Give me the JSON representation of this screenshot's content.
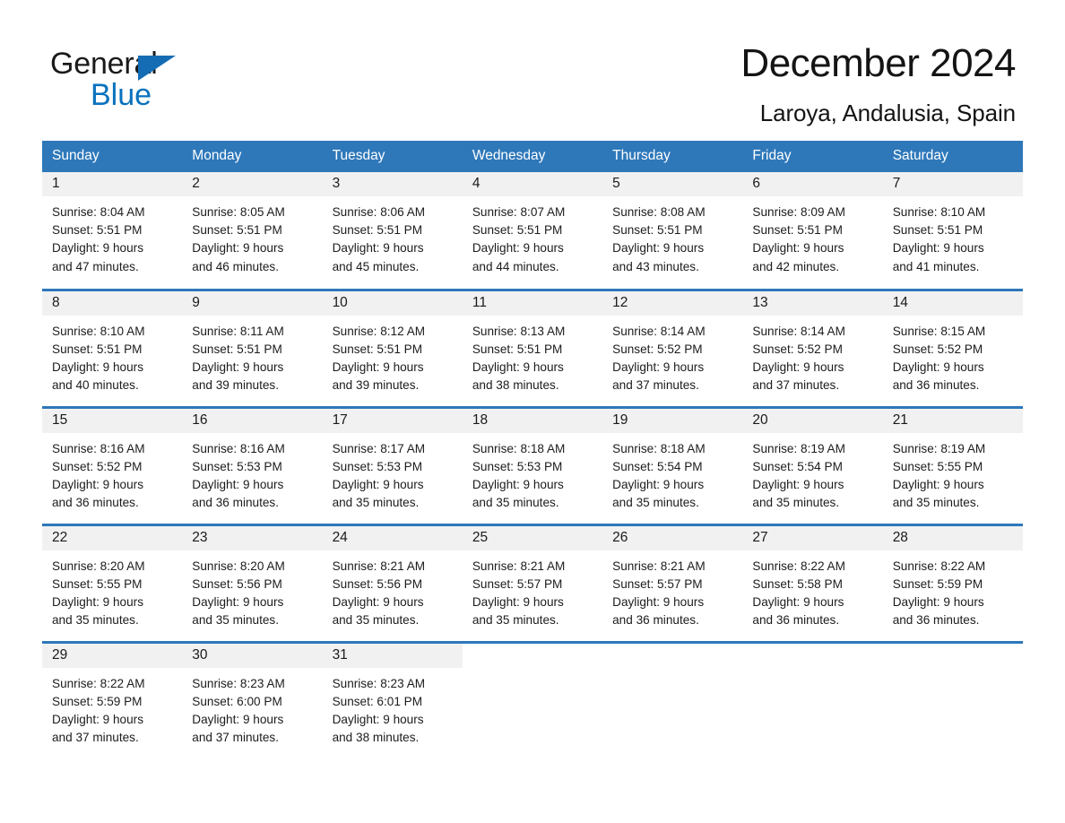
{
  "brand": {
    "name_top": "General",
    "name_bottom": "Blue",
    "accent_color": "#146cb4",
    "triangle_icon": "brand-triangle-icon"
  },
  "header": {
    "month_title": "December 2024",
    "location": "Laroya, Andalusia, Spain"
  },
  "theme": {
    "header_blue": "#2e78ba",
    "daynum_band": "#f1f1f1",
    "text": "#1a1a1a"
  },
  "calendar": {
    "weekday_headers": [
      "Sunday",
      "Monday",
      "Tuesday",
      "Wednesday",
      "Thursday",
      "Friday",
      "Saturday"
    ],
    "weeks": [
      [
        {
          "day": "1",
          "sunrise": "Sunrise: 8:04 AM",
          "sunset": "Sunset: 5:51 PM",
          "daylight_1": "Daylight: 9 hours",
          "daylight_2": "and 47 minutes."
        },
        {
          "day": "2",
          "sunrise": "Sunrise: 8:05 AM",
          "sunset": "Sunset: 5:51 PM",
          "daylight_1": "Daylight: 9 hours",
          "daylight_2": "and 46 minutes."
        },
        {
          "day": "3",
          "sunrise": "Sunrise: 8:06 AM",
          "sunset": "Sunset: 5:51 PM",
          "daylight_1": "Daylight: 9 hours",
          "daylight_2": "and 45 minutes."
        },
        {
          "day": "4",
          "sunrise": "Sunrise: 8:07 AM",
          "sunset": "Sunset: 5:51 PM",
          "daylight_1": "Daylight: 9 hours",
          "daylight_2": "and 44 minutes."
        },
        {
          "day": "5",
          "sunrise": "Sunrise: 8:08 AM",
          "sunset": "Sunset: 5:51 PM",
          "daylight_1": "Daylight: 9 hours",
          "daylight_2": "and 43 minutes."
        },
        {
          "day": "6",
          "sunrise": "Sunrise: 8:09 AM",
          "sunset": "Sunset: 5:51 PM",
          "daylight_1": "Daylight: 9 hours",
          "daylight_2": "and 42 minutes."
        },
        {
          "day": "7",
          "sunrise": "Sunrise: 8:10 AM",
          "sunset": "Sunset: 5:51 PM",
          "daylight_1": "Daylight: 9 hours",
          "daylight_2": "and 41 minutes."
        }
      ],
      [
        {
          "day": "8",
          "sunrise": "Sunrise: 8:10 AM",
          "sunset": "Sunset: 5:51 PM",
          "daylight_1": "Daylight: 9 hours",
          "daylight_2": "and 40 minutes."
        },
        {
          "day": "9",
          "sunrise": "Sunrise: 8:11 AM",
          "sunset": "Sunset: 5:51 PM",
          "daylight_1": "Daylight: 9 hours",
          "daylight_2": "and 39 minutes."
        },
        {
          "day": "10",
          "sunrise": "Sunrise: 8:12 AM",
          "sunset": "Sunset: 5:51 PM",
          "daylight_1": "Daylight: 9 hours",
          "daylight_2": "and 39 minutes."
        },
        {
          "day": "11",
          "sunrise": "Sunrise: 8:13 AM",
          "sunset": "Sunset: 5:51 PM",
          "daylight_1": "Daylight: 9 hours",
          "daylight_2": "and 38 minutes."
        },
        {
          "day": "12",
          "sunrise": "Sunrise: 8:14 AM",
          "sunset": "Sunset: 5:52 PM",
          "daylight_1": "Daylight: 9 hours",
          "daylight_2": "and 37 minutes."
        },
        {
          "day": "13",
          "sunrise": "Sunrise: 8:14 AM",
          "sunset": "Sunset: 5:52 PM",
          "daylight_1": "Daylight: 9 hours",
          "daylight_2": "and 37 minutes."
        },
        {
          "day": "14",
          "sunrise": "Sunrise: 8:15 AM",
          "sunset": "Sunset: 5:52 PM",
          "daylight_1": "Daylight: 9 hours",
          "daylight_2": "and 36 minutes."
        }
      ],
      [
        {
          "day": "15",
          "sunrise": "Sunrise: 8:16 AM",
          "sunset": "Sunset: 5:52 PM",
          "daylight_1": "Daylight: 9 hours",
          "daylight_2": "and 36 minutes."
        },
        {
          "day": "16",
          "sunrise": "Sunrise: 8:16 AM",
          "sunset": "Sunset: 5:53 PM",
          "daylight_1": "Daylight: 9 hours",
          "daylight_2": "and 36 minutes."
        },
        {
          "day": "17",
          "sunrise": "Sunrise: 8:17 AM",
          "sunset": "Sunset: 5:53 PM",
          "daylight_1": "Daylight: 9 hours",
          "daylight_2": "and 35 minutes."
        },
        {
          "day": "18",
          "sunrise": "Sunrise: 8:18 AM",
          "sunset": "Sunset: 5:53 PM",
          "daylight_1": "Daylight: 9 hours",
          "daylight_2": "and 35 minutes."
        },
        {
          "day": "19",
          "sunrise": "Sunrise: 8:18 AM",
          "sunset": "Sunset: 5:54 PM",
          "daylight_1": "Daylight: 9 hours",
          "daylight_2": "and 35 minutes."
        },
        {
          "day": "20",
          "sunrise": "Sunrise: 8:19 AM",
          "sunset": "Sunset: 5:54 PM",
          "daylight_1": "Daylight: 9 hours",
          "daylight_2": "and 35 minutes."
        },
        {
          "day": "21",
          "sunrise": "Sunrise: 8:19 AM",
          "sunset": "Sunset: 5:55 PM",
          "daylight_1": "Daylight: 9 hours",
          "daylight_2": "and 35 minutes."
        }
      ],
      [
        {
          "day": "22",
          "sunrise": "Sunrise: 8:20 AM",
          "sunset": "Sunset: 5:55 PM",
          "daylight_1": "Daylight: 9 hours",
          "daylight_2": "and 35 minutes."
        },
        {
          "day": "23",
          "sunrise": "Sunrise: 8:20 AM",
          "sunset": "Sunset: 5:56 PM",
          "daylight_1": "Daylight: 9 hours",
          "daylight_2": "and 35 minutes."
        },
        {
          "day": "24",
          "sunrise": "Sunrise: 8:21 AM",
          "sunset": "Sunset: 5:56 PM",
          "daylight_1": "Daylight: 9 hours",
          "daylight_2": "and 35 minutes."
        },
        {
          "day": "25",
          "sunrise": "Sunrise: 8:21 AM",
          "sunset": "Sunset: 5:57 PM",
          "daylight_1": "Daylight: 9 hours",
          "daylight_2": "and 35 minutes."
        },
        {
          "day": "26",
          "sunrise": "Sunrise: 8:21 AM",
          "sunset": "Sunset: 5:57 PM",
          "daylight_1": "Daylight: 9 hours",
          "daylight_2": "and 36 minutes."
        },
        {
          "day": "27",
          "sunrise": "Sunrise: 8:22 AM",
          "sunset": "Sunset: 5:58 PM",
          "daylight_1": "Daylight: 9 hours",
          "daylight_2": "and 36 minutes."
        },
        {
          "day": "28",
          "sunrise": "Sunrise: 8:22 AM",
          "sunset": "Sunset: 5:59 PM",
          "daylight_1": "Daylight: 9 hours",
          "daylight_2": "and 36 minutes."
        }
      ],
      [
        {
          "day": "29",
          "sunrise": "Sunrise: 8:22 AM",
          "sunset": "Sunset: 5:59 PM",
          "daylight_1": "Daylight: 9 hours",
          "daylight_2": "and 37 minutes."
        },
        {
          "day": "30",
          "sunrise": "Sunrise: 8:23 AM",
          "sunset": "Sunset: 6:00 PM",
          "daylight_1": "Daylight: 9 hours",
          "daylight_2": "and 37 minutes."
        },
        {
          "day": "31",
          "sunrise": "Sunrise: 8:23 AM",
          "sunset": "Sunset: 6:01 PM",
          "daylight_1": "Daylight: 9 hours",
          "daylight_2": "and 38 minutes."
        },
        {
          "day": "",
          "sunrise": "",
          "sunset": "",
          "daylight_1": "",
          "daylight_2": ""
        },
        {
          "day": "",
          "sunrise": "",
          "sunset": "",
          "daylight_1": "",
          "daylight_2": ""
        },
        {
          "day": "",
          "sunrise": "",
          "sunset": "",
          "daylight_1": "",
          "daylight_2": ""
        },
        {
          "day": "",
          "sunrise": "",
          "sunset": "",
          "daylight_1": "",
          "daylight_2": ""
        }
      ]
    ]
  }
}
